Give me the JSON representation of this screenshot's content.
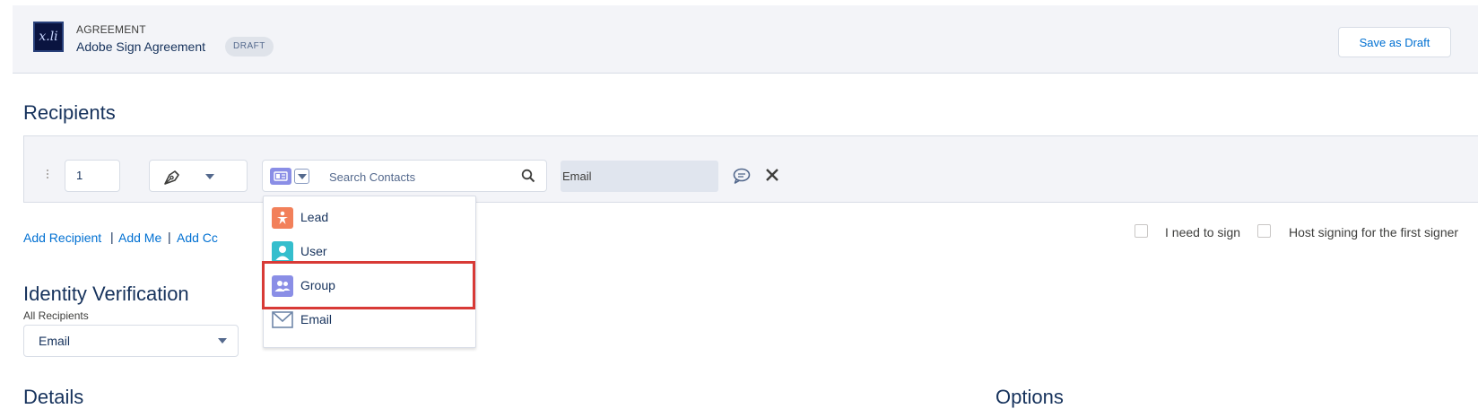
{
  "header": {
    "object_type": "AGREEMENT",
    "title": "Adobe Sign Agreement",
    "status_badge": "DRAFT",
    "save_button": "Save as Draft"
  },
  "recipients": {
    "section_title": "Recipients",
    "rows": [
      {
        "order": "1",
        "role_icon": "pen-nib-icon",
        "search_placeholder": "Search Contacts",
        "email_value": "Email"
      }
    ],
    "dropdown_items": [
      {
        "label": "Lead",
        "icon": "lead-icon",
        "color": "#f2805a"
      },
      {
        "label": "User",
        "icon": "user-icon",
        "color": "#34becd"
      },
      {
        "label": "Group",
        "icon": "group-icon",
        "color": "#8a8ee6",
        "highlighted": true
      },
      {
        "label": "Email",
        "icon": "email-icon",
        "color": "#6f87a9"
      }
    ],
    "links": {
      "add_recipient": "Add Recipient",
      "add_me": "Add Me",
      "add_cc": "Add Cc"
    },
    "separator": "|",
    "options": {
      "i_need_to_sign": "I need to sign",
      "host_signing": "Host signing for the first signer"
    }
  },
  "identity_verification": {
    "section_title": "Identity Verification",
    "label": "All Recipients",
    "selected": "Email"
  },
  "bottom_sections": {
    "left_title": "Details",
    "right_title": "Options"
  },
  "colors": {
    "link": "#0070d2",
    "text": "#16325c",
    "header_bg": "#f3f4f8",
    "highlight": "#d83a36"
  }
}
